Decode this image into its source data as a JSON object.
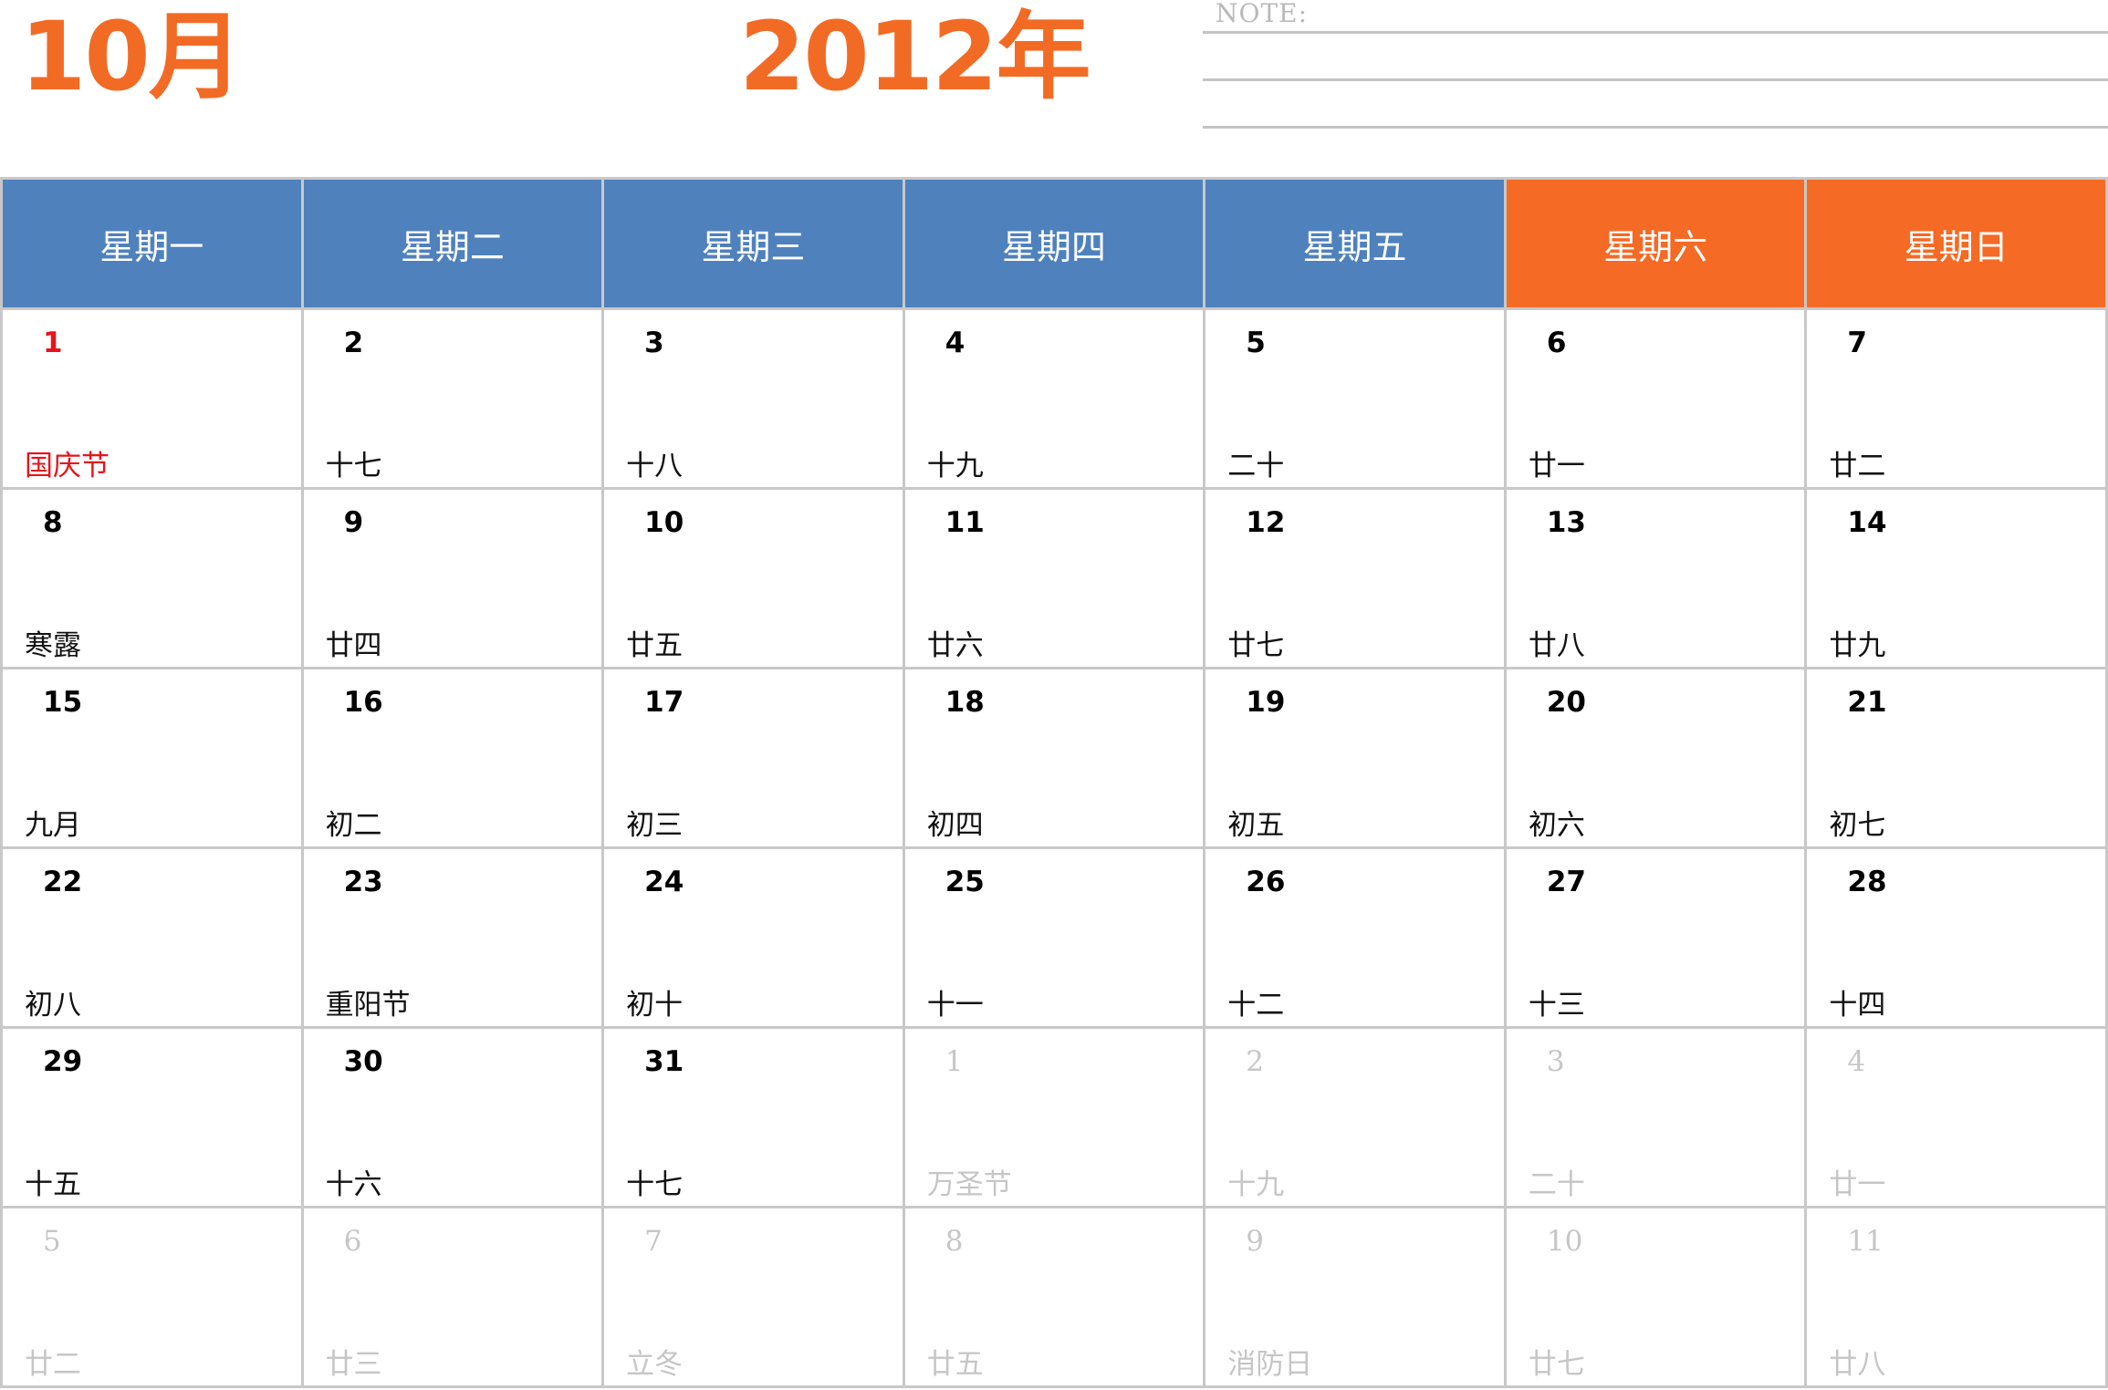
{
  "header": {
    "month": "10月",
    "year": "2012年",
    "note_label": "NOTE:"
  },
  "colors": {
    "accent": "#f26b25",
    "weekday_header": "#4f81bd",
    "weekend_header": "#f56a25",
    "holiday_text": "#e8131b",
    "muted_text": "#c6c6c6",
    "grid_line": "#c8c8c8"
  },
  "weekdays": [
    {
      "label": "星期一",
      "weekend": false
    },
    {
      "label": "星期二",
      "weekend": false
    },
    {
      "label": "星期三",
      "weekend": false
    },
    {
      "label": "星期四",
      "weekend": false
    },
    {
      "label": "星期五",
      "weekend": false
    },
    {
      "label": "星期六",
      "weekend": true
    },
    {
      "label": "星期日",
      "weekend": true
    }
  ],
  "weeks": [
    [
      {
        "day": "1",
        "lunar": "国庆节",
        "holiday": true,
        "current": true
      },
      {
        "day": "2",
        "lunar": "十七",
        "current": true
      },
      {
        "day": "3",
        "lunar": "十八",
        "current": true
      },
      {
        "day": "4",
        "lunar": "十九",
        "current": true
      },
      {
        "day": "5",
        "lunar": "二十",
        "current": true
      },
      {
        "day": "6",
        "lunar": "廿一",
        "current": true
      },
      {
        "day": "7",
        "lunar": "廿二",
        "current": true
      }
    ],
    [
      {
        "day": "8",
        "lunar": "寒露",
        "current": true
      },
      {
        "day": "9",
        "lunar": "廿四",
        "current": true
      },
      {
        "day": "10",
        "lunar": "廿五",
        "current": true
      },
      {
        "day": "11",
        "lunar": "廿六",
        "current": true
      },
      {
        "day": "12",
        "lunar": "廿七",
        "current": true
      },
      {
        "day": "13",
        "lunar": "廿八",
        "current": true
      },
      {
        "day": "14",
        "lunar": "廿九",
        "current": true
      }
    ],
    [
      {
        "day": "15",
        "lunar": "九月",
        "current": true
      },
      {
        "day": "16",
        "lunar": "初二",
        "current": true
      },
      {
        "day": "17",
        "lunar": "初三",
        "current": true
      },
      {
        "day": "18",
        "lunar": "初四",
        "current": true
      },
      {
        "day": "19",
        "lunar": "初五",
        "current": true
      },
      {
        "day": "20",
        "lunar": "初六",
        "current": true
      },
      {
        "day": "21",
        "lunar": "初七",
        "current": true
      }
    ],
    [
      {
        "day": "22",
        "lunar": "初八",
        "current": true
      },
      {
        "day": "23",
        "lunar": "重阳节",
        "current": true
      },
      {
        "day": "24",
        "lunar": "初十",
        "current": true
      },
      {
        "day": "25",
        "lunar": "十一",
        "current": true
      },
      {
        "day": "26",
        "lunar": "十二",
        "current": true
      },
      {
        "day": "27",
        "lunar": "十三",
        "current": true
      },
      {
        "day": "28",
        "lunar": "十四",
        "current": true
      }
    ],
    [
      {
        "day": "29",
        "lunar": "十五",
        "current": true
      },
      {
        "day": "30",
        "lunar": "十六",
        "current": true
      },
      {
        "day": "31",
        "lunar": "十七",
        "current": true
      },
      {
        "day": "1",
        "lunar": "万圣节",
        "current": false
      },
      {
        "day": "2",
        "lunar": "十九",
        "current": false
      },
      {
        "day": "3",
        "lunar": "二十",
        "current": false
      },
      {
        "day": "4",
        "lunar": "廿一",
        "current": false
      }
    ],
    [
      {
        "day": "5",
        "lunar": "廿二",
        "current": false
      },
      {
        "day": "6",
        "lunar": "廿三",
        "current": false
      },
      {
        "day": "7",
        "lunar": "立冬",
        "current": false
      },
      {
        "day": "8",
        "lunar": "廿五",
        "current": false
      },
      {
        "day": "9",
        "lunar": "消防日",
        "current": false
      },
      {
        "day": "10",
        "lunar": "廿七",
        "current": false
      },
      {
        "day": "11",
        "lunar": "廿八",
        "current": false
      }
    ]
  ]
}
